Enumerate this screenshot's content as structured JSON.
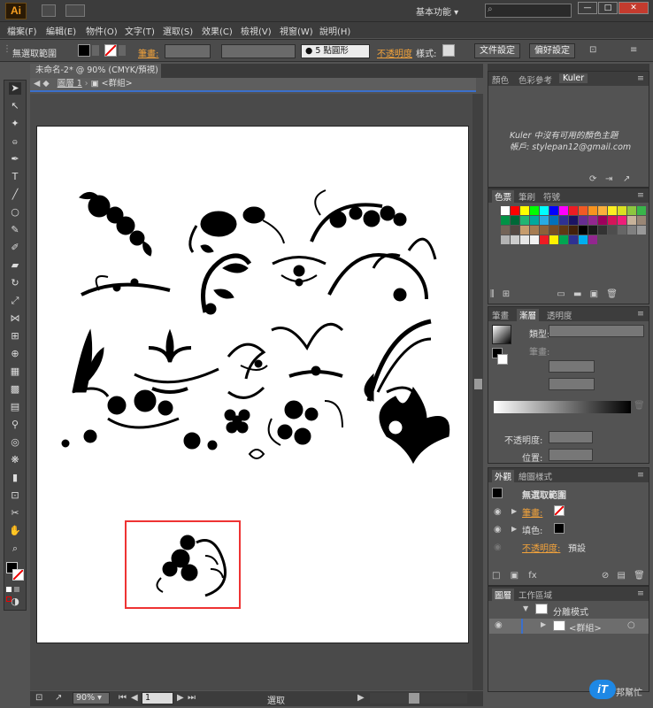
{
  "app": {
    "logo": "Ai",
    "workspace": "基本功能",
    "window_buttons": [
      "—",
      "□",
      "✕"
    ]
  },
  "menu": [
    "檔案(F)",
    "編輯(E)",
    "物件(O)",
    "文字(T)",
    "選取(S)",
    "效果(C)",
    "檢視(V)",
    "視窗(W)",
    "說明(H)"
  ],
  "control": {
    "selection_label": "無選取範圍",
    "stroke_label": "筆畫:",
    "brush_label": "5 點圓形",
    "opacity_label": "不透明度",
    "style_label": "樣式:",
    "doc_settings": "文件設定",
    "prefs": "偏好設定"
  },
  "document": {
    "tab_title": "未命名-2* @ 90% (CMYK/預視)",
    "layer_crumb": "圖層 1",
    "group_crumb": "<群組>"
  },
  "status": {
    "zoom": "90%",
    "artboard_num": "1",
    "selection_text": "選取"
  },
  "kuler": {
    "tabs": [
      "顏色",
      "色彩參考",
      "Kuler"
    ],
    "message_line1": "Kuler 中沒有可用的顏色主題",
    "message_line2": "帳戶: stylepan12@gmail.com"
  },
  "swatches_panel": {
    "tabs": [
      "色票",
      "筆刷",
      "符號"
    ],
    "colors": [
      "#ffffff",
      "#ff0000",
      "#ffff00",
      "#00ff00",
      "#00ffff",
      "#0000ff",
      "#ff00ff",
      "#ed1c24",
      "#f15a24",
      "#f7931e",
      "#fbb03b",
      "#fcee21",
      "#d9e021",
      "#8cc63f",
      "#39b54a",
      "#009245",
      "#006837",
      "#22b573",
      "#00a99d",
      "#29abe2",
      "#0071bc",
      "#2e3192",
      "#1b1464",
      "#662d91",
      "#93278f",
      "#9e005d",
      "#d4145a",
      "#ed1e79",
      "#c7b299",
      "#998675",
      "#736357",
      "#534741",
      "#c69c6d",
      "#a67c52",
      "#8c6239",
      "#754c24",
      "#603813",
      "#42210b",
      "#000000",
      "#1a1a1a",
      "#333333",
      "#4d4d4d",
      "#666666",
      "#808080",
      "#999999",
      "#b3b3b3",
      "#cccccc",
      "#e6e6e6",
      "#f2f2f2",
      "#ed1c24",
      "#fff200",
      "#00a651",
      "#2e3192",
      "#00aeef",
      "#92278f"
    ]
  },
  "stroke_panel": {
    "tabs": [
      "筆畫",
      "漸層",
      "透明度"
    ],
    "type_label": "類型:",
    "stroke_label": "筆畫:",
    "opacity_label": "不透明度:",
    "position_label": "位置:"
  },
  "appearance": {
    "tabs": [
      "外觀",
      "繪圖樣式"
    ],
    "header": "無選取範圍",
    "stroke": "筆畫:",
    "fill": "填色:",
    "opacity": "不透明度:",
    "opacity_value": "預設"
  },
  "layers": {
    "tabs": [
      "圖層",
      "工作區域"
    ],
    "rows": [
      {
        "name": "分離模式"
      },
      {
        "name": "<群組>"
      }
    ]
  },
  "watermark": {
    "text1": "iT",
    "text2": "邦幫忙"
  }
}
